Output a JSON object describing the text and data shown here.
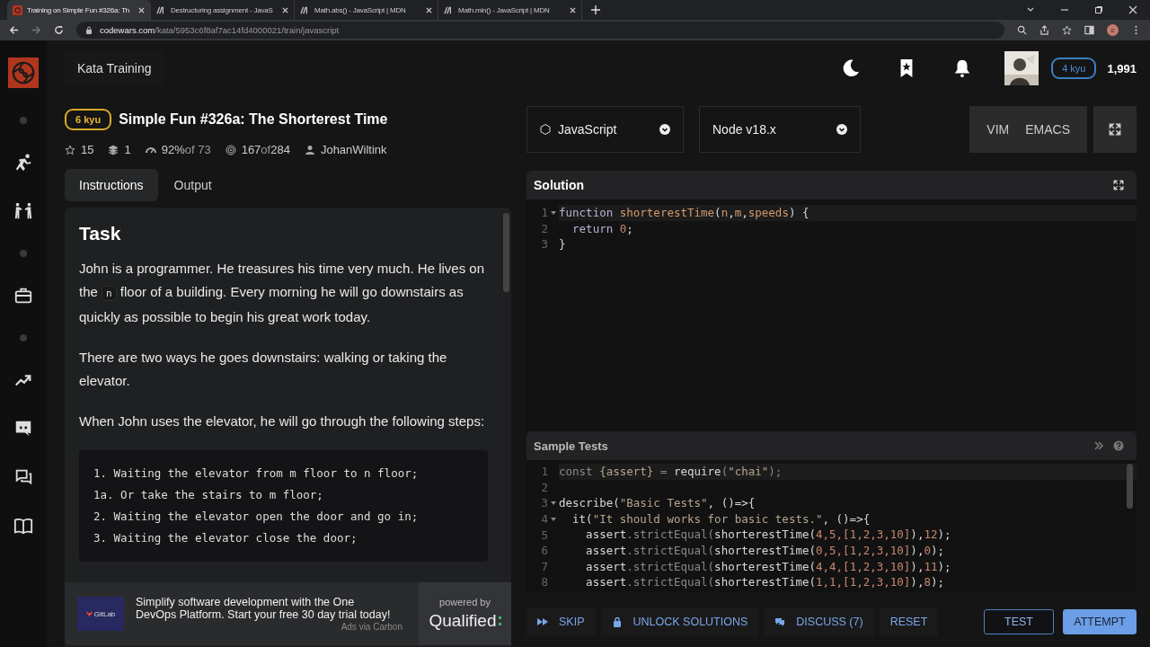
{
  "browser": {
    "tabs": [
      {
        "title": "Training on Simple Fun #326a: Th",
        "selected": true
      },
      {
        "title": "Destructuring assignment - JavaS",
        "selected": false
      },
      {
        "title": "Math.abs() - JavaScript | MDN",
        "selected": false
      },
      {
        "title": "Math.min() - JavaScript | MDN",
        "selected": false
      }
    ],
    "url_host": "codewars.com",
    "url_path": "/kata/5953c6f8af7ac14fd4000021/train/javascript",
    "profile_initial": "c"
  },
  "header": {
    "section": "Kata Training",
    "rank": "4 kyu",
    "honor": "1,991"
  },
  "kata": {
    "rank": "6 kyu",
    "title": "Simple Fun #326a: The Shorterest Time",
    "stats": [
      {
        "kind": "stars",
        "value": "15"
      },
      {
        "kind": "collections",
        "value": "1"
      },
      {
        "kind": "satisfaction",
        "value": "92%",
        "suffix": "of 73"
      },
      {
        "kind": "completed",
        "value": "167",
        "suffix": "of",
        "total": "284"
      },
      {
        "kind": "author",
        "value": "JohanWiltink"
      }
    ]
  },
  "left_tabs": [
    {
      "label": "Instructions",
      "selected": true
    },
    {
      "label": "Output",
      "selected": false
    }
  ],
  "instructions": {
    "heading": "Task",
    "paragraphs": [
      [
        {
          "kind": "text",
          "text": "John is a programmer. He treasures his time very much. He lives on the "
        },
        {
          "kind": "code",
          "text": "n"
        },
        {
          "kind": "text",
          "text": " floor of a building. Every morning he will go downstairs as quickly as possible to begin his great work today."
        }
      ],
      [
        {
          "kind": "text",
          "text": "There are two ways he goes downstairs: walking or taking the elevator."
        }
      ],
      [
        {
          "kind": "text",
          "text": "When John uses the elevator, he will go through the following steps:"
        }
      ]
    ],
    "code_block": [
      "1. Waiting the elevator from m floor to n floor;",
      "1a. Or take the stairs to m floor;",
      "2. Waiting the elevator open the door and go in;",
      "3. Waiting the elevator close the door;"
    ]
  },
  "ad": {
    "brand": "GitLab",
    "text": "Simplify software development with the One DevOps Platform. Start your free 30 day trial today!",
    "via": "Ads via Carbon",
    "powered_by": "powered by",
    "platform": "Qualified"
  },
  "language": "JavaScript",
  "runtime": "Node v18.x",
  "modes": [
    "VIM",
    "EMACS"
  ],
  "solution": {
    "title": "Solution",
    "lines": [
      {
        "n": "1",
        "fold": true,
        "current": true,
        "tokens": [
          {
            "kind": "kw",
            "text": "function "
          },
          {
            "kind": "fn",
            "text": "shorterestTime"
          },
          {
            "kind": "p",
            "text": "("
          },
          {
            "kind": "fn",
            "text": "n"
          },
          {
            "kind": "p",
            "text": ","
          },
          {
            "kind": "fn",
            "text": "m"
          },
          {
            "kind": "p",
            "text": ","
          },
          {
            "kind": "fn",
            "text": "speeds"
          },
          {
            "kind": "p",
            "text": ") {"
          }
        ]
      },
      {
        "n": "2",
        "fold": false,
        "current": false,
        "tokens": [
          {
            "kind": "kw",
            "text": "  return "
          },
          {
            "kind": "num",
            "text": "0"
          },
          {
            "kind": "p",
            "text": ";"
          }
        ]
      },
      {
        "n": "3",
        "fold": false,
        "current": false,
        "tokens": [
          {
            "kind": "p",
            "text": "}"
          }
        ]
      }
    ]
  },
  "tests": {
    "title": "Sample Tests",
    "lines": [
      {
        "n": "1",
        "fold": false,
        "current": true,
        "tokens": [
          {
            "kind": "dim",
            "text": "const "
          },
          {
            "kind": "str",
            "text": "{assert}"
          },
          {
            "kind": "dim",
            "text": " = "
          },
          {
            "kind": "p",
            "text": "require"
          },
          {
            "kind": "dim",
            "text": "("
          },
          {
            "kind": "str",
            "text": "\"chai\""
          },
          {
            "kind": "dim",
            "text": ");"
          }
        ]
      },
      {
        "n": "2",
        "fold": false,
        "current": false
      },
      {
        "n": "3",
        "fold": true,
        "current": false,
        "tokens": [
          {
            "kind": "p",
            "text": "describe("
          },
          {
            "kind": "str",
            "text": "\"Basic Tests\""
          },
          {
            "kind": "p",
            "text": ", ()=>{"
          }
        ]
      },
      {
        "n": "4",
        "fold": true,
        "current": false,
        "tokens": [
          {
            "kind": "p",
            "text": "  it("
          },
          {
            "kind": "str",
            "text": "\"It should works for basic tests.\""
          },
          {
            "kind": "p",
            "text": ", ()=>{"
          }
        ]
      },
      {
        "n": "5",
        "fold": false,
        "current": false,
        "tokens": [
          {
            "kind": "p",
            "text": "    assert"
          },
          {
            "kind": "dim",
            "text": ".strictEqual("
          },
          {
            "kind": "p",
            "text": "shorterestTime("
          },
          {
            "kind": "num",
            "text": "4,5,[1,2,3,10]"
          },
          {
            "kind": "p",
            "text": "),"
          },
          {
            "kind": "num",
            "text": "12"
          },
          {
            "kind": "p",
            "text": ");"
          }
        ]
      },
      {
        "n": "6",
        "fold": false,
        "current": false,
        "tokens": [
          {
            "kind": "p",
            "text": "    assert"
          },
          {
            "kind": "dim",
            "text": ".strictEqual("
          },
          {
            "kind": "p",
            "text": "shorterestTime("
          },
          {
            "kind": "num",
            "text": "0,5,[1,2,3,10]"
          },
          {
            "kind": "p",
            "text": "),"
          },
          {
            "kind": "num",
            "text": "0"
          },
          {
            "kind": "p",
            "text": ");"
          }
        ]
      },
      {
        "n": "7",
        "fold": false,
        "current": false,
        "tokens": [
          {
            "kind": "p",
            "text": "    assert"
          },
          {
            "kind": "dim",
            "text": ".strictEqual("
          },
          {
            "kind": "p",
            "text": "shorterestTime("
          },
          {
            "kind": "num",
            "text": "4,4,[1,2,3,10]"
          },
          {
            "kind": "p",
            "text": "),"
          },
          {
            "kind": "num",
            "text": "11"
          },
          {
            "kind": "p",
            "text": ");"
          }
        ]
      },
      {
        "n": "8",
        "fold": false,
        "current": false,
        "tokens": [
          {
            "kind": "p",
            "text": "    assert"
          },
          {
            "kind": "dim",
            "text": ".strictEqual("
          },
          {
            "kind": "p",
            "text": "shorterestTime("
          },
          {
            "kind": "num",
            "text": "1,1,[1,2,3,10]"
          },
          {
            "kind": "p",
            "text": "),"
          },
          {
            "kind": "num",
            "text": "8"
          },
          {
            "kind": "p",
            "text": ");"
          }
        ]
      }
    ]
  },
  "actions": [
    {
      "label": "SKIP",
      "kind": "skip"
    },
    {
      "label": "UNLOCK SOLUTIONS",
      "kind": "unlock"
    },
    {
      "label": "DISCUSS (7)",
      "kind": "discuss"
    },
    {
      "label": "RESET",
      "kind": "reset"
    }
  ],
  "run_buttons": [
    {
      "label": "TEST",
      "primary": false
    },
    {
      "label": "ATTEMPT",
      "primary": true
    }
  ]
}
